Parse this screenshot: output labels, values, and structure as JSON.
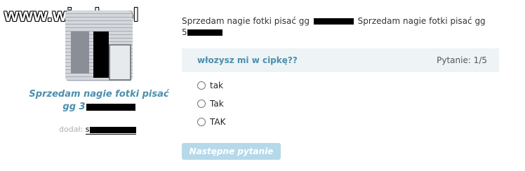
{
  "watermark": "www.wiocha.pl",
  "post": {
    "title": "Sprzedam nagie fotki pisać gg 3",
    "added_label": "dodał:",
    "added_user": "s",
    "description_part1": "Sprzedam nagie fotki pisać gg",
    "description_part2": "Sprzedam nagie fotki pisać gg",
    "description_part3": "5"
  },
  "quiz": {
    "question": "włozysz mi w cipkę??",
    "counter": "Pytanie: 1/5",
    "answers": [
      "tak",
      "Tak",
      "TAK"
    ],
    "next_label": "Następne pytanie"
  }
}
